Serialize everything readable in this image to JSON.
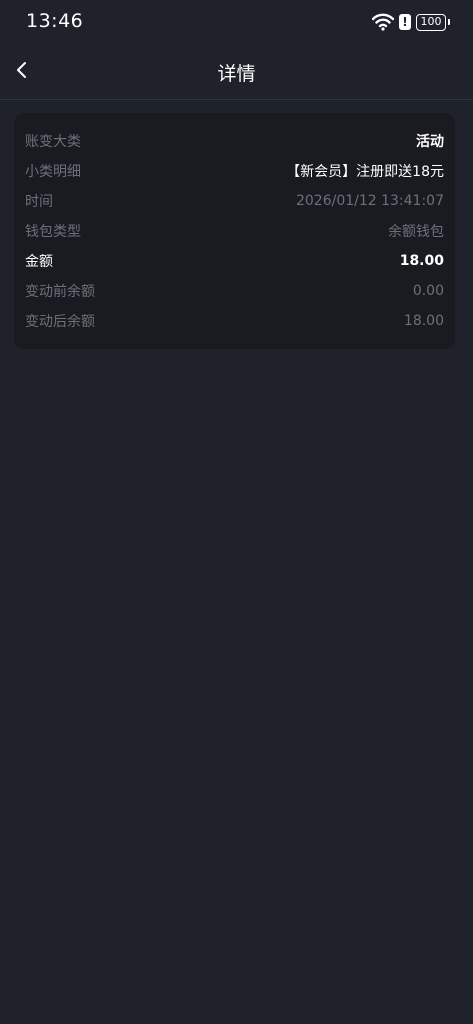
{
  "status_bar": {
    "time": "13:46",
    "battery": "100",
    "icons": [
      "wifi-icon",
      "alert-icon",
      "battery-icon"
    ]
  },
  "nav": {
    "title": "详情",
    "back_icon": "chevron-left-icon"
  },
  "details": {
    "category_label": "账变大类",
    "category_value": "活动",
    "subcategory_label": "小类明细",
    "subcategory_value": "【新会员】注册即送18元",
    "time_label": "时间",
    "time_value": "2026/01/12 13:41:07",
    "wallet_type_label": "钱包类型",
    "wallet_type_value": "余额钱包",
    "amount_label": "金额",
    "amount_value": "18.00",
    "balance_before_label": "变动前余额",
    "balance_before_value": "0.00",
    "balance_after_label": "变动后余额",
    "balance_after_value": "18.00"
  },
  "colors": {
    "background": "#1f222a",
    "card": "#191b20",
    "muted_text": "#6a707c",
    "primary_text": "#ffffff"
  }
}
